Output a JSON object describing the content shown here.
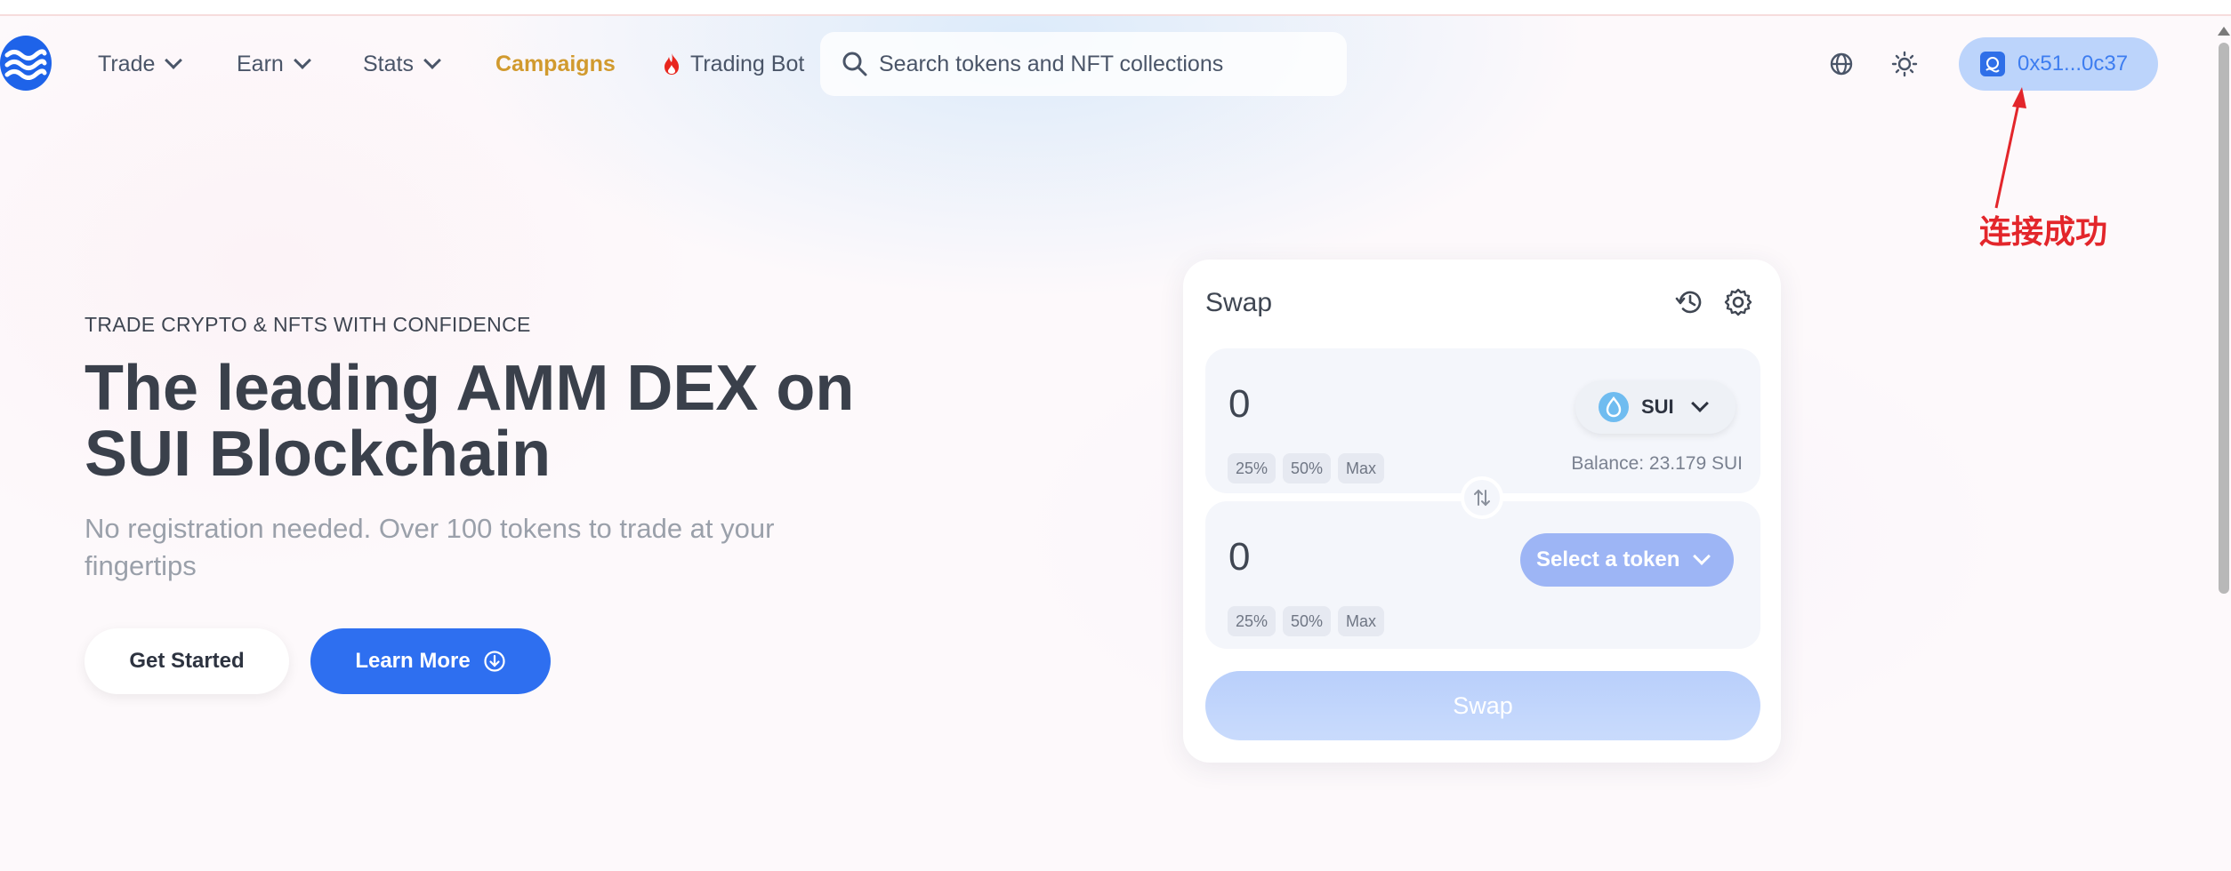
{
  "header": {
    "nav": [
      {
        "label": "Trade"
      },
      {
        "label": "Earn"
      },
      {
        "label": "Stats"
      },
      {
        "label": "Campaigns"
      },
      {
        "label": "Trading Bot"
      }
    ],
    "search_placeholder": "Search tokens and NFT collections",
    "wallet_address": "0x51...0c37"
  },
  "annotation": {
    "text": "连接成功"
  },
  "hero": {
    "eyebrow": "TRADE CRYPTO & NFTS WITH CONFIDENCE",
    "headline_line1": "The leading AMM DEX on",
    "headline_line2": "SUI Blockchain",
    "subheadline": "No registration needed. Over 100 tokens to trade at your fingertips",
    "get_started_label": "Get Started",
    "learn_more_label": "Learn More"
  },
  "swap": {
    "title": "Swap",
    "from": {
      "amount": "0",
      "token": "SUI",
      "balance": "Balance: 23.179 SUI",
      "percents": [
        "25%",
        "50%",
        "Max"
      ]
    },
    "to": {
      "amount": "0",
      "select_label": "Select a token",
      "percents": [
        "25%",
        "50%",
        "Max"
      ]
    },
    "submit_label": "Swap"
  },
  "colors": {
    "brand_blue": "#1e63e9",
    "campaigns_gold": "#d19a2e",
    "annotation_red": "#e3262b"
  }
}
